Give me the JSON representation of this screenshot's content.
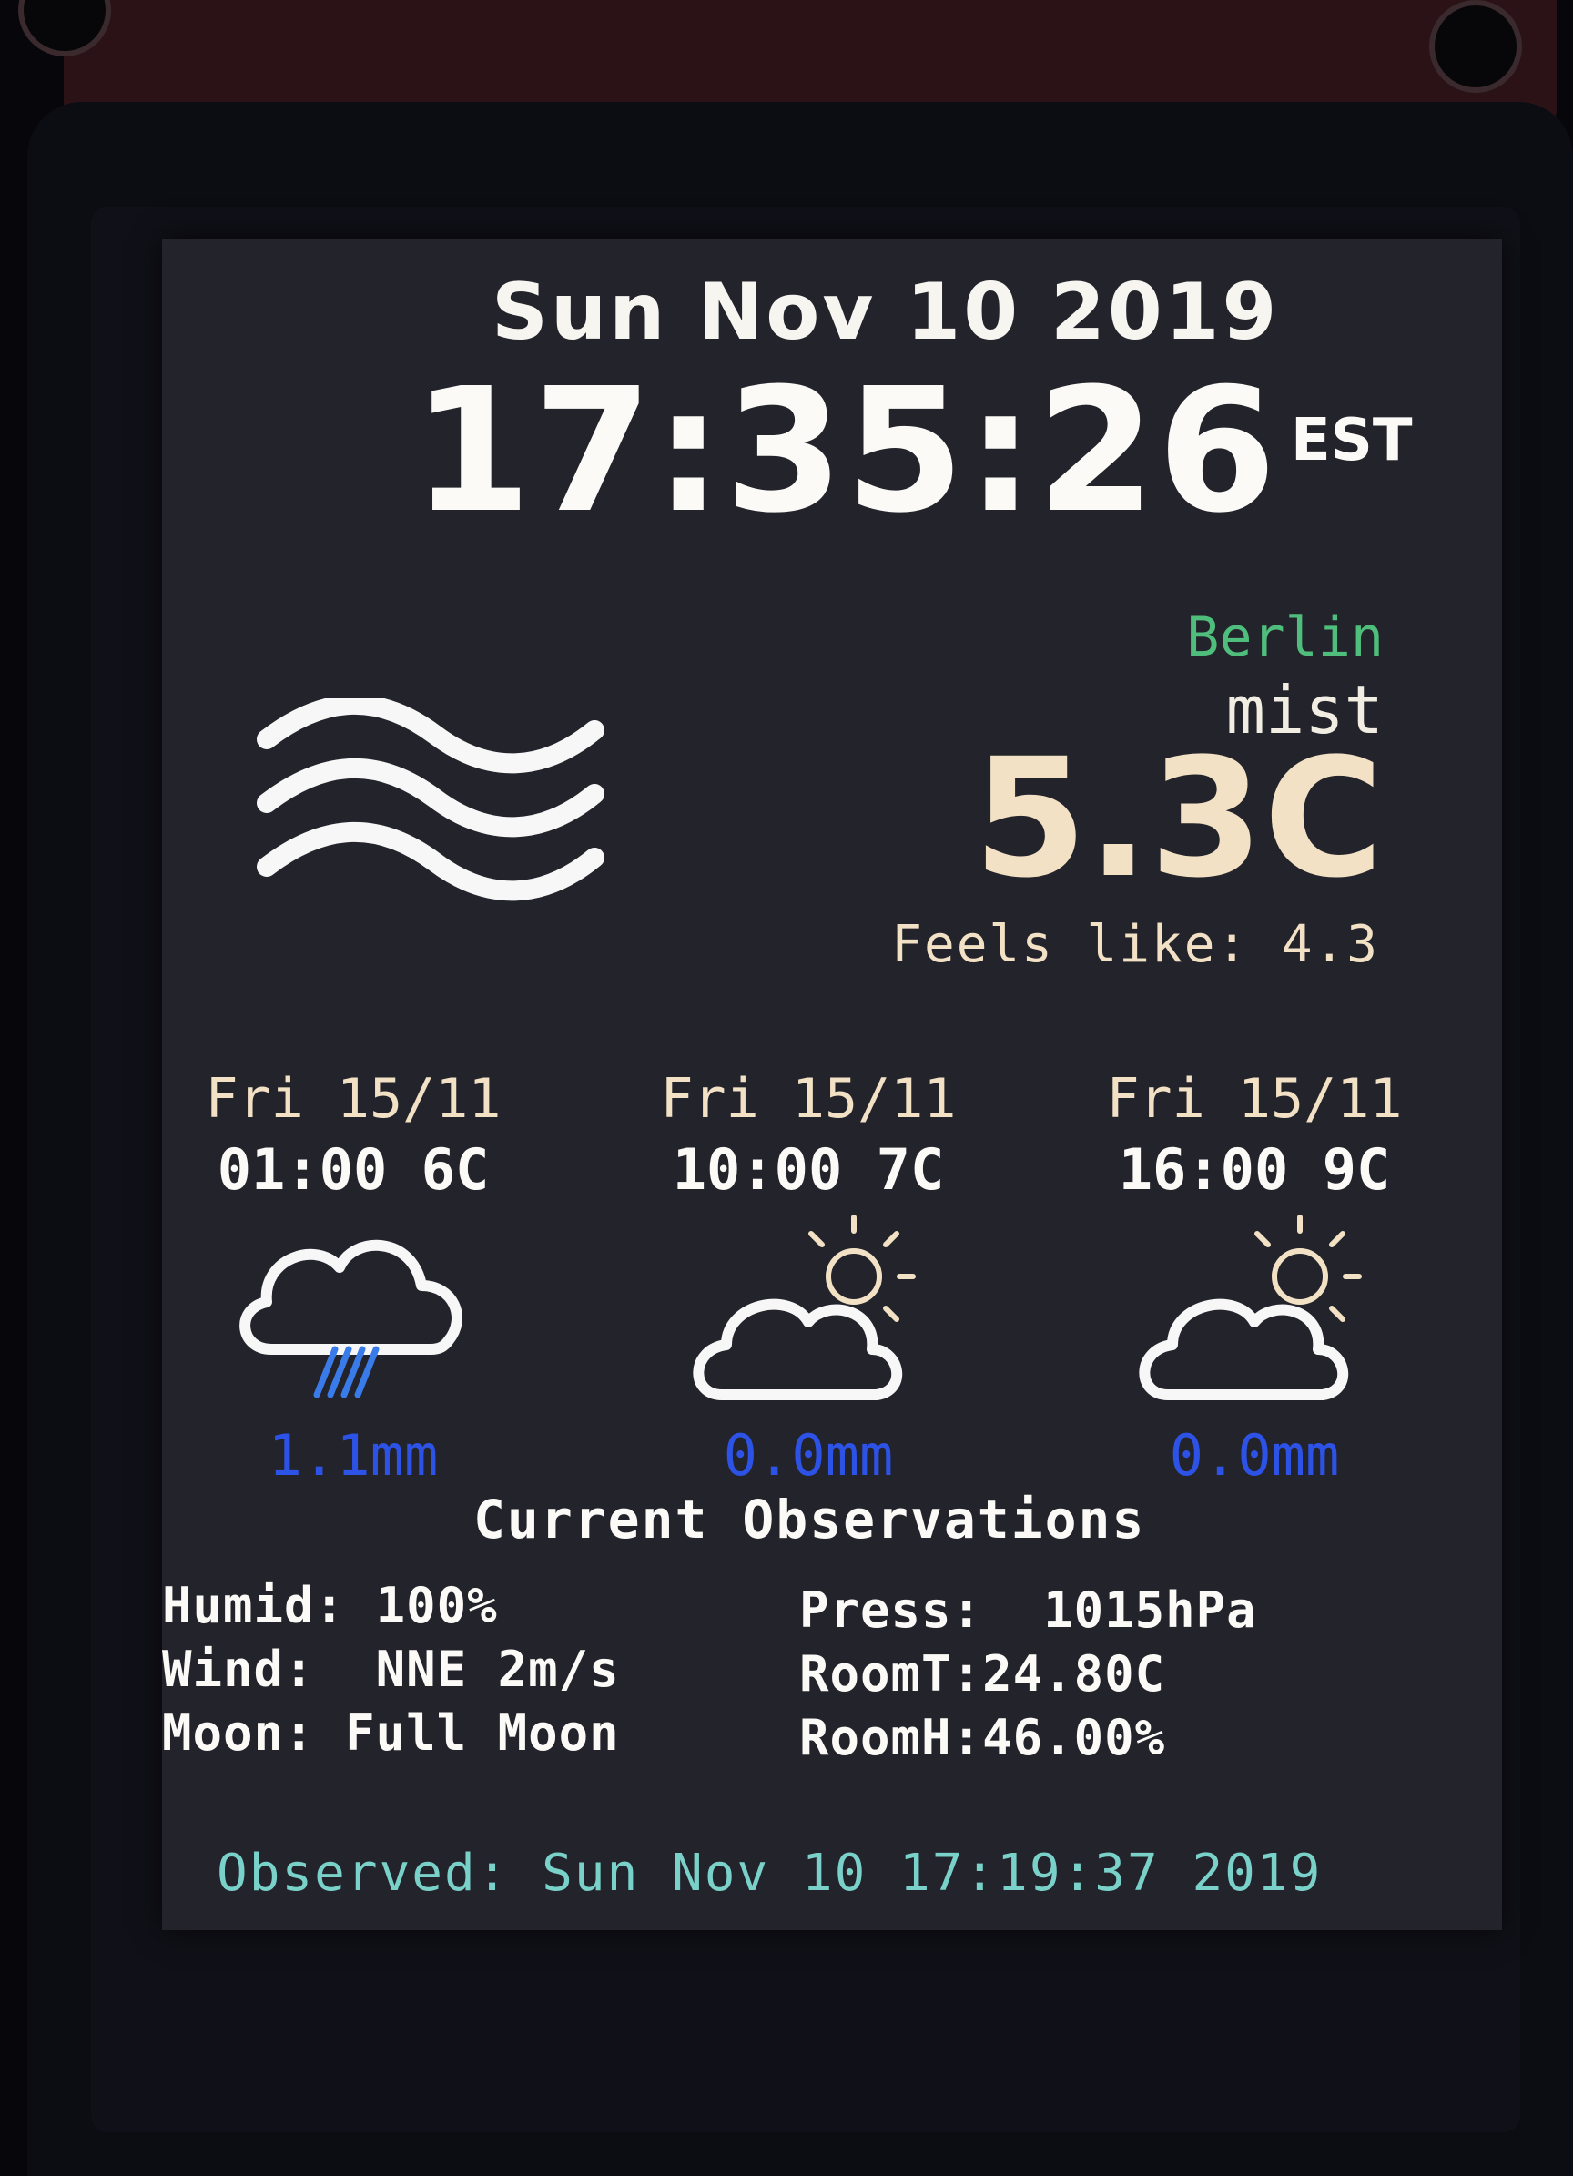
{
  "header": {
    "date": "Sun Nov 10 2019",
    "time": "17:35:26",
    "timezone": "EST"
  },
  "current": {
    "city": "Berlin",
    "condition": "mist",
    "temperature": "5.3C",
    "feels_like": "Feels like: 4.3",
    "icon": "mist-icon"
  },
  "forecast": [
    {
      "day": "Fri 15/11",
      "hour_temp": "01:00  6C",
      "rain": "1.1mm",
      "icon": "cloud-rain-icon"
    },
    {
      "day": "Fri 15/11",
      "hour_temp": "10:00  7C",
      "rain": "0.0mm",
      "icon": "partly-cloudy-icon"
    },
    {
      "day": "Fri 15/11",
      "hour_temp": "16:00  9C",
      "rain": "0.0mm",
      "icon": "partly-cloudy-icon"
    }
  ],
  "observations": {
    "title": "Current Observations",
    "left": [
      {
        "text": "Humid: 100%"
      },
      {
        "text": "Wind:  NNE 2m/s"
      },
      {
        "text": "Moon: Full Moon"
      }
    ],
    "right": [
      {
        "text": "Press:  1015hPa"
      },
      {
        "text": "RoomT:24.80C"
      },
      {
        "text": "RoomH:46.00%"
      }
    ]
  },
  "observed": "Observed: Sun Nov 10 17:19:37 2019",
  "colors": {
    "screen_bg": "#23232b",
    "city": "#4fbe7c",
    "temperature": "#f2e1c4",
    "rain": "#2d52e6",
    "observed": "#79d1c9"
  }
}
